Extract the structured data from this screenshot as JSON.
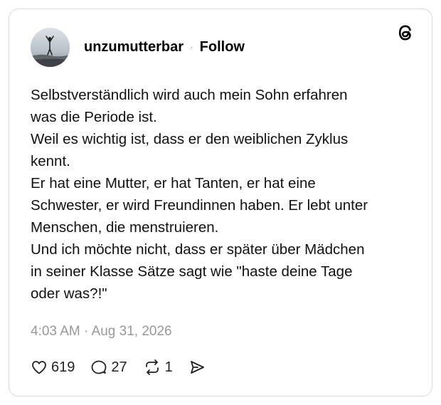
{
  "header": {
    "username": "unzumutterbar",
    "separator": "·",
    "follow_label": "Follow"
  },
  "post": {
    "lines": [
      "Selbstverständlich wird auch mein Sohn erfahren",
      "was die Periode ist.",
      "Weil es wichtig ist, dass er den weiblichen Zyklus",
      "kennt.",
      "Er hat eine Mutter, er hat Tanten, er hat eine",
      "Schwester, er wird Freundinnen haben. Er lebt unter",
      "Menschen, die menstruieren.",
      "Und ich möchte nicht, dass er später über Mädchen",
      "in seiner Klasse Sätze sagt wie \"haste deine Tage",
      "oder was?!\""
    ],
    "timestamp": "4:03 AM · Aug 31, 2026"
  },
  "actions": {
    "likes": "619",
    "replies": "27",
    "reposts": "1"
  },
  "icons": {
    "like": "heart-icon",
    "reply": "speech-bubble-icon",
    "repost": "repost-arrows-icon",
    "share": "send-icon",
    "brand": "threads-logo-icon"
  }
}
